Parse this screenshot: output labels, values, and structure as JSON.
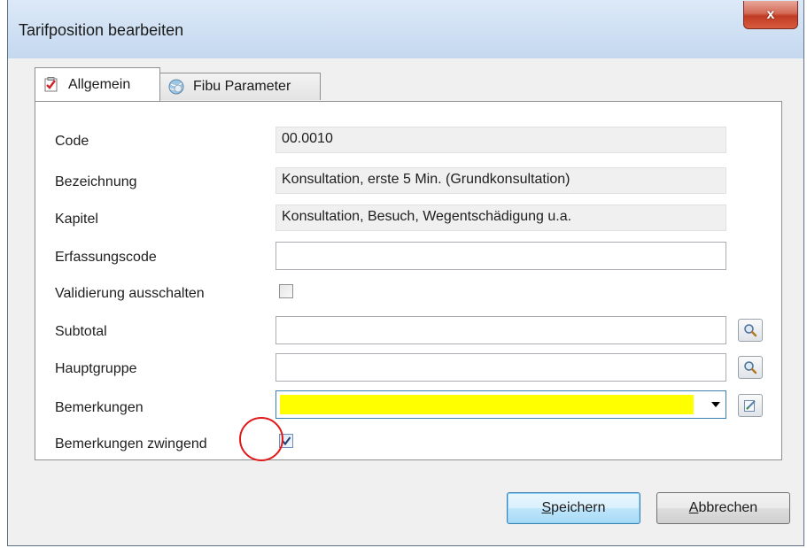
{
  "window": {
    "title": "Tarifposition bearbeiten",
    "close_symbol": "x"
  },
  "tabs": [
    {
      "label": "Allgemein",
      "icon": "checklist-icon",
      "active": true
    },
    {
      "label": "Fibu Parameter",
      "icon": "globe-icon",
      "active": false
    }
  ],
  "form": {
    "code_label": "Code",
    "code_value": "00.0010",
    "bezeichnung_label": "Bezeichnung",
    "bezeichnung_value": "Konsultation, erste 5 Min. (Grundkonsultation)",
    "kapitel_label": "Kapitel",
    "kapitel_value": "Konsultation, Besuch, Wegentschädigung u.a.",
    "erfassungscode_label": "Erfassungscode",
    "erfassungscode_value": "",
    "validierung_label": "Validierung ausschalten",
    "validierung_checked": false,
    "subtotal_label": "Subtotal",
    "subtotal_value": "",
    "hauptgruppe_label": "Hauptgruppe",
    "hauptgruppe_value": "",
    "bemerkungen_label": "Bemerkungen",
    "bemerkungen_value": "",
    "bemerkungen_highlight_color": "#ffff00",
    "bemerkungen_zwingend_label": "Bemerkungen zwingend",
    "bemerkungen_zwingend_checked": true,
    "annotation_color": "#e01818"
  },
  "buttons": {
    "save_mnemonic": "S",
    "save_rest": "peichern",
    "cancel_mnemonic": "A",
    "cancel_rest": "bbrechen"
  }
}
